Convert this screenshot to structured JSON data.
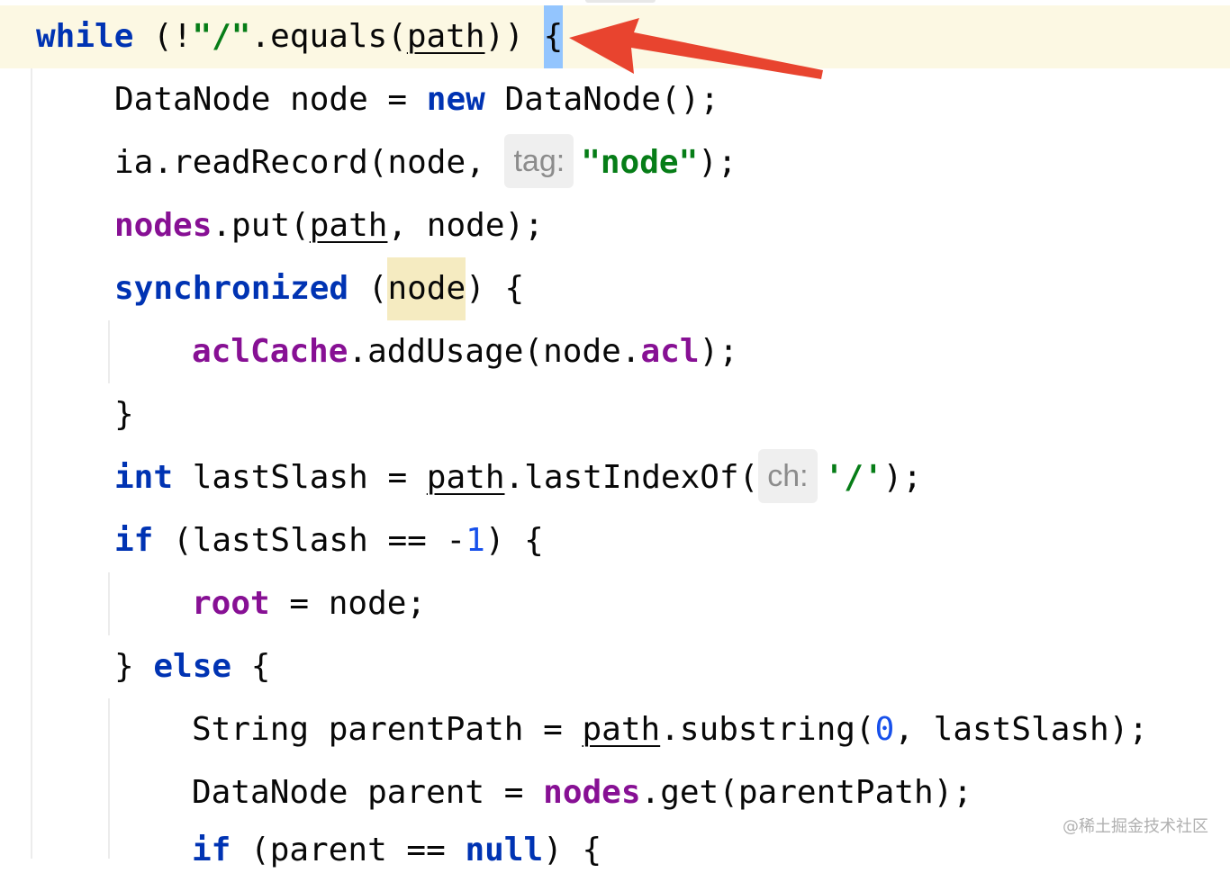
{
  "lines": {
    "l1": {
      "kw_while": "while",
      "pre": " (!",
      "str": "\"/\"",
      "mid": ".equals(",
      "path": "path",
      "post": ")) ",
      "brace": "{"
    },
    "l2": {
      "pre": "DataNode node = ",
      "kw_new": "new",
      "post": " DataNode();"
    },
    "l3": {
      "pre": "ia.readRecord(node, ",
      "hint": "tag:",
      "str": "\"node\"",
      "post": ");"
    },
    "l4": {
      "fld": "nodes",
      "mid": ".put(",
      "path": "path",
      "post": ", node);"
    },
    "l5": {
      "kw": "synchronized",
      "open": " (",
      "node": "node",
      "post": ") {"
    },
    "l6": {
      "fld": "aclCache",
      "mid": ".addUsage(node.",
      "fld2": "acl",
      "post": ");"
    },
    "l7": {
      "text": "}"
    },
    "l8": {
      "kw": "int",
      "mid": " lastSlash = ",
      "path": "path",
      "call": ".lastIndexOf(",
      "hint": "ch:",
      "str": "'/'",
      "post": ");"
    },
    "l9": {
      "kw": "if",
      "mid": " (lastSlash == -",
      "num": "1",
      "post": ") {"
    },
    "l10": {
      "fld": "root",
      "post": " = node;"
    },
    "l11": {
      "pre": "} ",
      "kw": "else",
      "post": " {"
    },
    "l12": {
      "pre": "String parentPath = ",
      "path": "path",
      "call": ".substring(",
      "num": "0",
      "post": ", lastSlash);"
    },
    "l13": {
      "pre": "DataNode parent = ",
      "fld": "nodes",
      "post": ".get(parentPath);"
    },
    "l14": {
      "kw": "if",
      "mid": " (parent == ",
      "kw2": "null",
      "post": ") {"
    }
  },
  "watermark": "@稀土掘金技术社区",
  "colors": {
    "keyword": "#0033b3",
    "string": "#067d17",
    "number": "#1750eb",
    "field": "#871094",
    "current_line": "#fcf8e3",
    "brace_highlight": "#93c5fe",
    "identifier_highlight": "#f5ebc1",
    "arrow": "#e8442f"
  }
}
